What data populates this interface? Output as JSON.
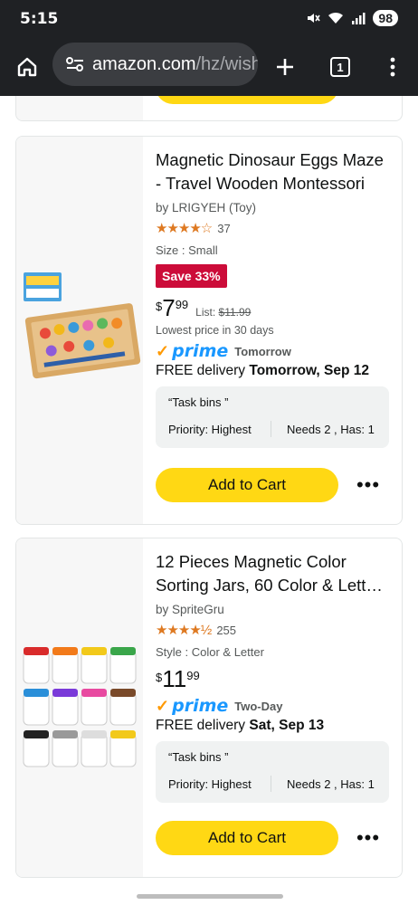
{
  "status_bar": {
    "time": "5:15",
    "battery": "98"
  },
  "browser": {
    "url_host": "amazon.com",
    "url_path": "/hz/wishlist",
    "tab_count": "1"
  },
  "items": [
    {
      "title": "Magnetic Dinosaur Eggs Maze - Travel Wooden Montessori T…",
      "byline": "by LRIGYEH (Toy)",
      "stars": "★★★★☆",
      "review_count": "37",
      "variant": "Size : Small",
      "save_badge": "Save 33%",
      "price_currency": "$",
      "price_whole": "7",
      "price_fraction": "99",
      "list_label": "List:",
      "list_price": "$11.99",
      "lowest_price_note": "Lowest price in 30 days",
      "prime_label": "prime",
      "prime_speed": "Tomorrow",
      "delivery_prefix": "FREE delivery",
      "delivery_date": "Tomorrow, Sep 12",
      "list_name": "“Task bins ”",
      "priority": "Priority: Highest",
      "needs_has": "Needs 2 , Has: 1",
      "add_to_cart": "Add to Cart",
      "more_icon": "•••"
    },
    {
      "title": "12 Pieces Magnetic Color Sorting Jars, 60 Color & Lett…",
      "byline": "by SpriteGru",
      "stars": "★★★★½",
      "review_count": "255",
      "variant": "Style : Color & Letter",
      "price_currency": "$",
      "price_whole": "11",
      "price_fraction": "99",
      "prime_label": "prime",
      "prime_speed": "Two-Day",
      "delivery_prefix": "FREE delivery",
      "delivery_date": "Sat, Sep 13",
      "list_name": "“Task bins ”",
      "priority": "Priority: Highest",
      "needs_has": "Needs 2 , Has: 1",
      "add_to_cart": "Add to Cart",
      "more_icon": "•••"
    }
  ],
  "colors": {
    "add_to_cart": "#ffd814",
    "save_badge": "#cc0c39",
    "prime_blue": "#1a98ff",
    "prime_check": "#ff9900",
    "star": "#de7921",
    "chrome_bg": "#1f2124"
  }
}
